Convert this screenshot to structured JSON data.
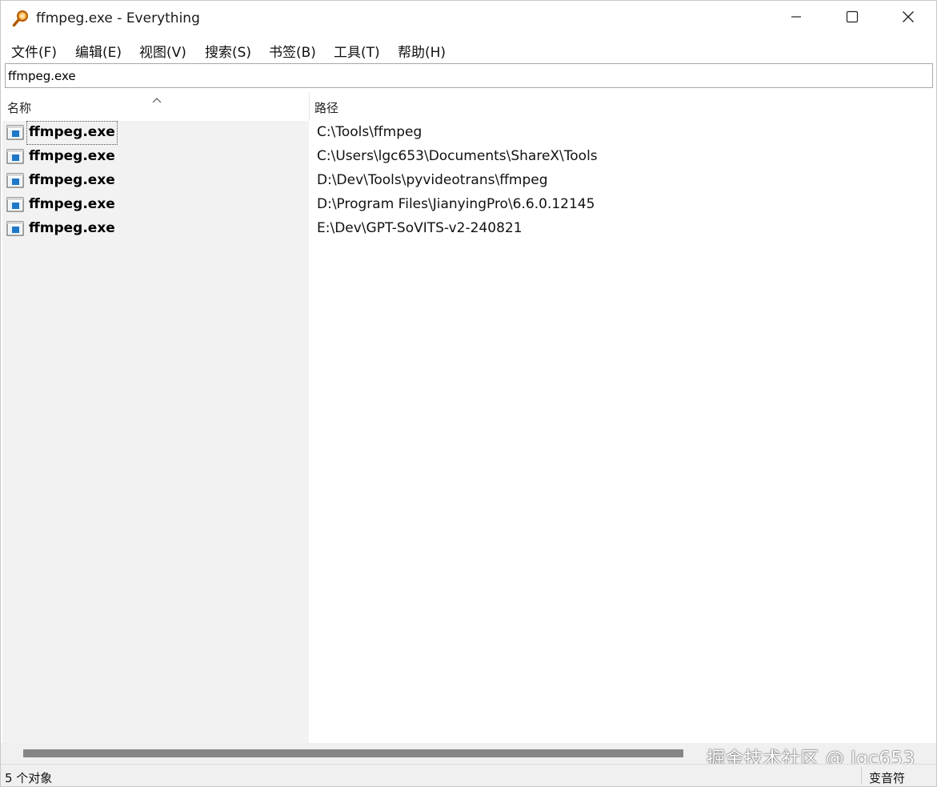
{
  "window": {
    "title": "ffmpeg.exe - Everything",
    "app_icon": "magnifier-icon",
    "controls": [
      "minimize-icon",
      "maximize-icon",
      "close-icon"
    ]
  },
  "menu": {
    "items": [
      {
        "label": "文件(F)"
      },
      {
        "label": "编辑(E)"
      },
      {
        "label": "视图(V)"
      },
      {
        "label": "搜索(S)"
      },
      {
        "label": "书签(B)"
      },
      {
        "label": "工具(T)"
      },
      {
        "label": "帮助(H)"
      }
    ]
  },
  "search": {
    "value": "ffmpeg.exe"
  },
  "columns": {
    "name": "名称",
    "path": "路径",
    "sort": "ascending"
  },
  "results": [
    {
      "name": "ffmpeg.exe",
      "path": "C:\\Tools\\ffmpeg",
      "icon": "executable-icon"
    },
    {
      "name": "ffmpeg.exe",
      "path": "C:\\Users\\lgc653\\Documents\\ShareX\\Tools",
      "icon": "executable-icon"
    },
    {
      "name": "ffmpeg.exe",
      "path": "D:\\Dev\\Tools\\pyvideotrans\\ffmpeg",
      "icon": "executable-icon"
    },
    {
      "name": "ffmpeg.exe",
      "path": "D:\\Program Files\\JianyingPro\\6.6.0.12145",
      "icon": "executable-icon"
    },
    {
      "name": "ffmpeg.exe",
      "path": "E:\\Dev\\GPT-SoVITS-v2-240821",
      "icon": "executable-icon"
    }
  ],
  "watermark": "掘金技术社区 @ lgc653",
  "status": {
    "count": "5 个对象",
    "right": "变音符"
  },
  "colors": {
    "name_column_bg": "#f2f2f2",
    "scroll_thumb": "#858585",
    "icon_blue": "#1e78c8"
  }
}
